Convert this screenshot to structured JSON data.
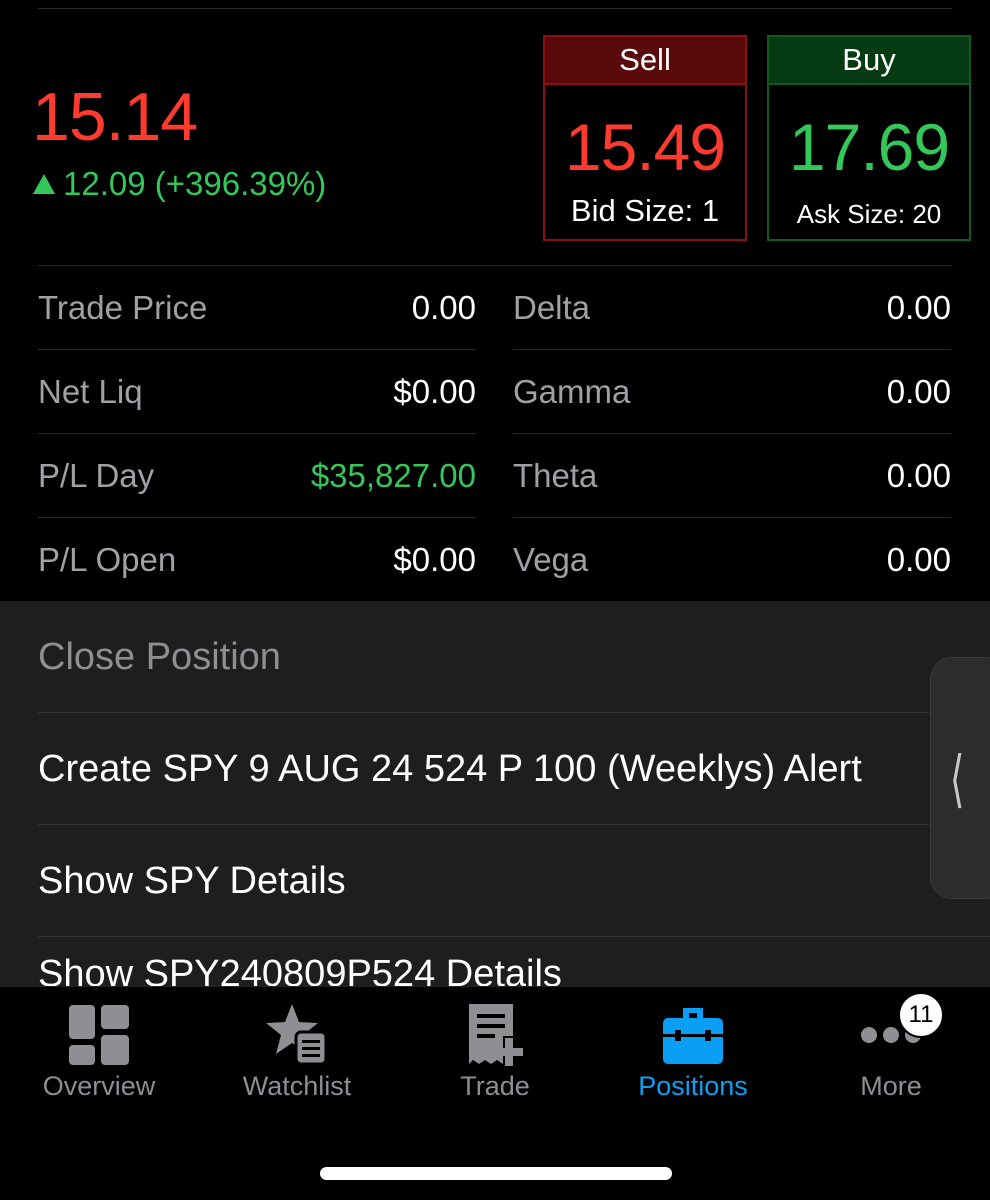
{
  "quote": {
    "last_price": "15.14",
    "change": "12.09 (+396.39%)",
    "sell": {
      "label": "Sell",
      "price": "15.49",
      "size": "Bid Size: 1"
    },
    "buy": {
      "label": "Buy",
      "price": "17.69",
      "size": "Ask Size: 20"
    }
  },
  "metrics": {
    "left": [
      {
        "label": "Trade Price",
        "value": "0.00"
      },
      {
        "label": "Net Liq",
        "value": "$0.00"
      },
      {
        "label": "P/L Day",
        "value": "$35,827.00"
      },
      {
        "label": "P/L Open",
        "value": "$0.00"
      }
    ],
    "right": [
      {
        "label": "Delta",
        "value": "0.00"
      },
      {
        "label": "Gamma",
        "value": "0.00"
      },
      {
        "label": "Theta",
        "value": "0.00"
      },
      {
        "label": "Vega",
        "value": "0.00"
      }
    ]
  },
  "action_sheet": {
    "items": [
      {
        "label": "Close Position"
      },
      {
        "label": "Create SPY 9 AUG 24 524 P 100 (Weeklys) Alert"
      },
      {
        "label": "Show SPY Details"
      },
      {
        "label": "Show SPY240809P524 Details"
      }
    ]
  },
  "tabbar": {
    "tabs": [
      {
        "label": "Overview",
        "icon": "overview-grid-icon"
      },
      {
        "label": "Watchlist",
        "icon": "watchlist-star-icon"
      },
      {
        "label": "Trade",
        "icon": "trade-ticket-icon"
      },
      {
        "label": "Positions",
        "icon": "briefcase-icon"
      },
      {
        "label": "More",
        "icon": "more-dots-icon"
      }
    ],
    "more_badge": "11"
  },
  "colors": {
    "down": "#ff3b30",
    "up": "#34c759",
    "active_tab": "#0a9ff5"
  }
}
